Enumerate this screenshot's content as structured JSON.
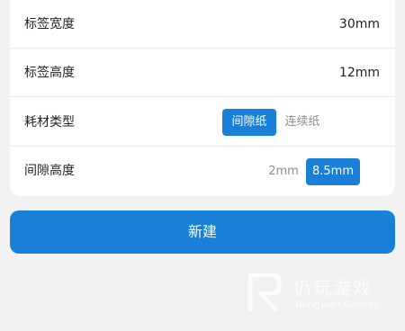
{
  "settings": {
    "rows": [
      {
        "label": "标签宽度",
        "value": "30mm"
      },
      {
        "label": "标签高度",
        "value": "12mm"
      },
      {
        "label": "耗材类型",
        "options": [
          "间隙纸",
          "连续纸"
        ],
        "selected": "间隙纸"
      },
      {
        "label": "间隙高度",
        "options": [
          "2mm",
          "8.5mm"
        ],
        "selected": "8.5mm"
      }
    ]
  },
  "actions": {
    "new_label": "新建"
  },
  "watermark": {
    "brand": "仍玩游戏",
    "sub": "Rengwan Games"
  },
  "colors": {
    "accent": "#1a7fd6",
    "background": "#f2f2f2",
    "card": "#ffffff"
  }
}
